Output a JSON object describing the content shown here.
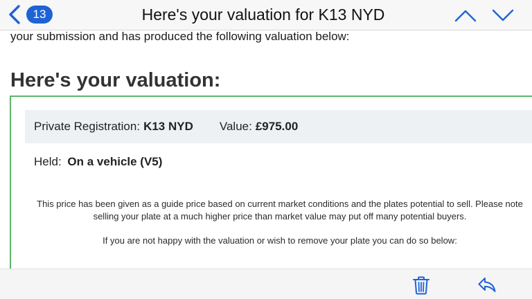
{
  "navbar": {
    "back_count": "13",
    "title": "Here's your valuation for K13 NYD"
  },
  "content": {
    "intro_text": "your submission and has produced the following valuation below:",
    "heading": "Here's your valuation:",
    "registration": {
      "label": "Private Registration:",
      "value": "K13 NYD",
      "value_label": "Value:",
      "value_amount": "£975.00"
    },
    "held": {
      "label": "Held:",
      "value": "On a vehicle (V5)"
    },
    "disclaimer": "This price has been given as a guide price based on current market conditions and the plates potential to sell. Please note selling your plate at a much higher price than market value may put off many potential buyers.",
    "remove_text": "If you are not happy with the valuation or wish to remove your plate you can do so below:"
  },
  "colors": {
    "accent_blue": "#1e63d6",
    "box_green": "#5cb56a",
    "row_background": "#eef1f4"
  },
  "icons": {
    "back": "chevron-left-icon",
    "previous": "chevron-up-icon",
    "next": "chevron-down-icon",
    "delete": "trash-icon",
    "reply": "reply-icon"
  }
}
